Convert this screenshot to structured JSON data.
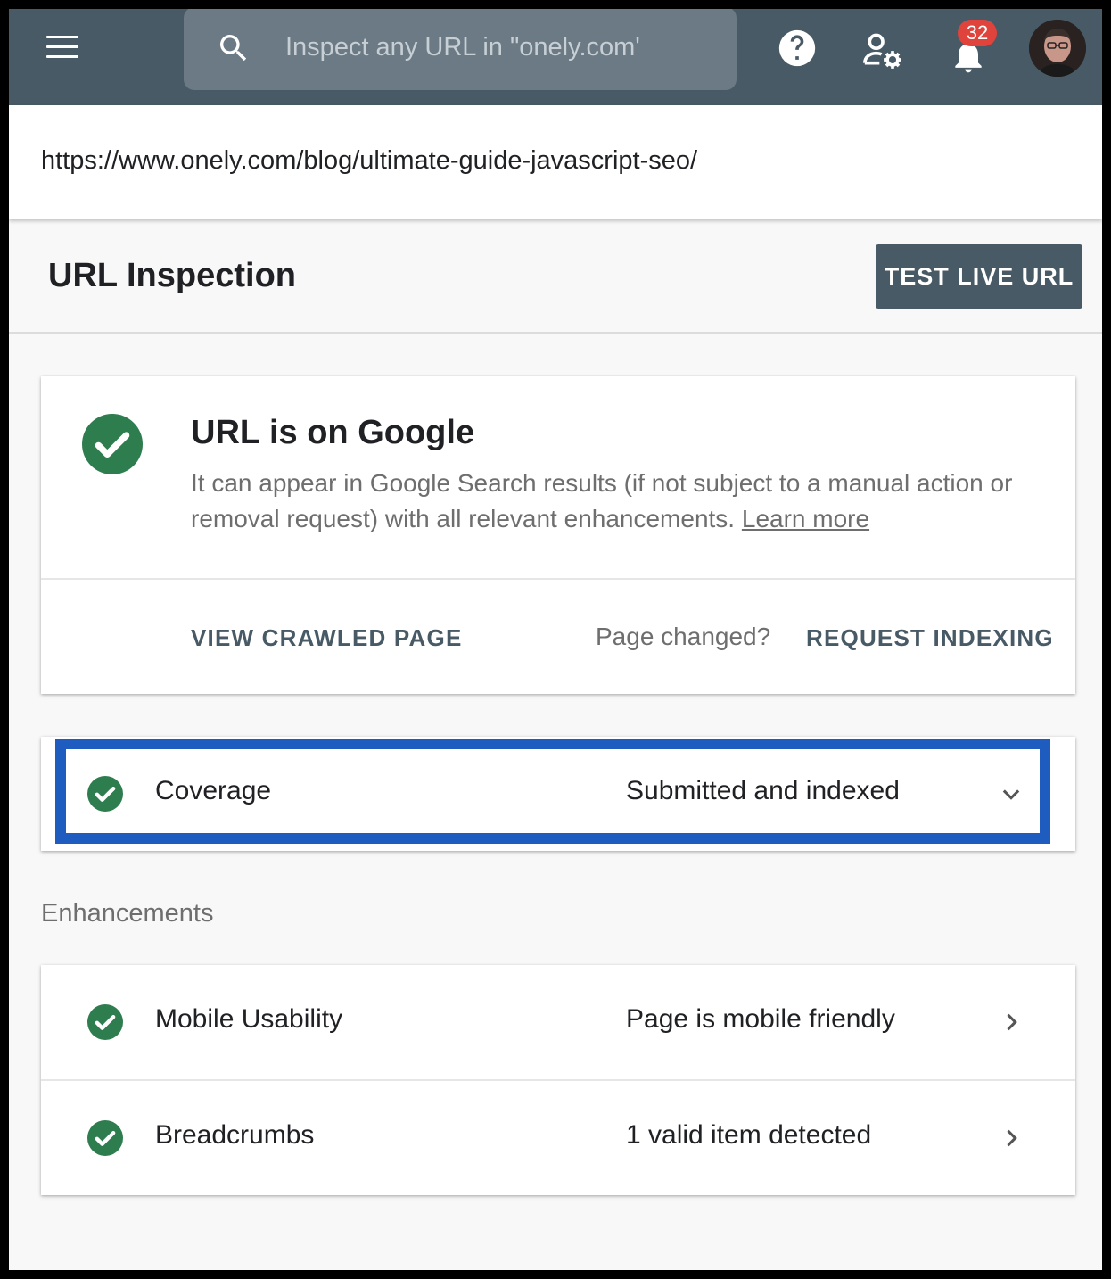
{
  "topbar": {
    "search_placeholder": "Inspect any URL in \"onely.com'",
    "notifications_count": "32"
  },
  "url_strip": {
    "url": "https://www.onely.com/blog/ultimate-guide-javascript-seo/"
  },
  "header": {
    "title": "URL Inspection",
    "test_live_label": "TEST LIVE URL"
  },
  "status": {
    "title": "URL is on Google",
    "description": "It can appear in Google Search results (if not subject to a manual action or removal request) with all relevant enhancements.",
    "learn_more": "Learn more",
    "view_crawled": "VIEW CRAWLED PAGE",
    "page_changed": "Page changed?",
    "request_indexing": "REQUEST INDEXING"
  },
  "coverage": {
    "label": "Coverage",
    "value": "Submitted and indexed"
  },
  "enhancements": {
    "title": "Enhancements",
    "items": [
      {
        "label": "Mobile Usability",
        "value": "Page is mobile friendly"
      },
      {
        "label": "Breadcrumbs",
        "value": "1 valid item detected"
      }
    ]
  },
  "colors": {
    "topbar": "#485a66",
    "success_green": "#2e7d4f",
    "highlight_blue": "#1f5cbf",
    "badge_red": "#e0433b"
  }
}
